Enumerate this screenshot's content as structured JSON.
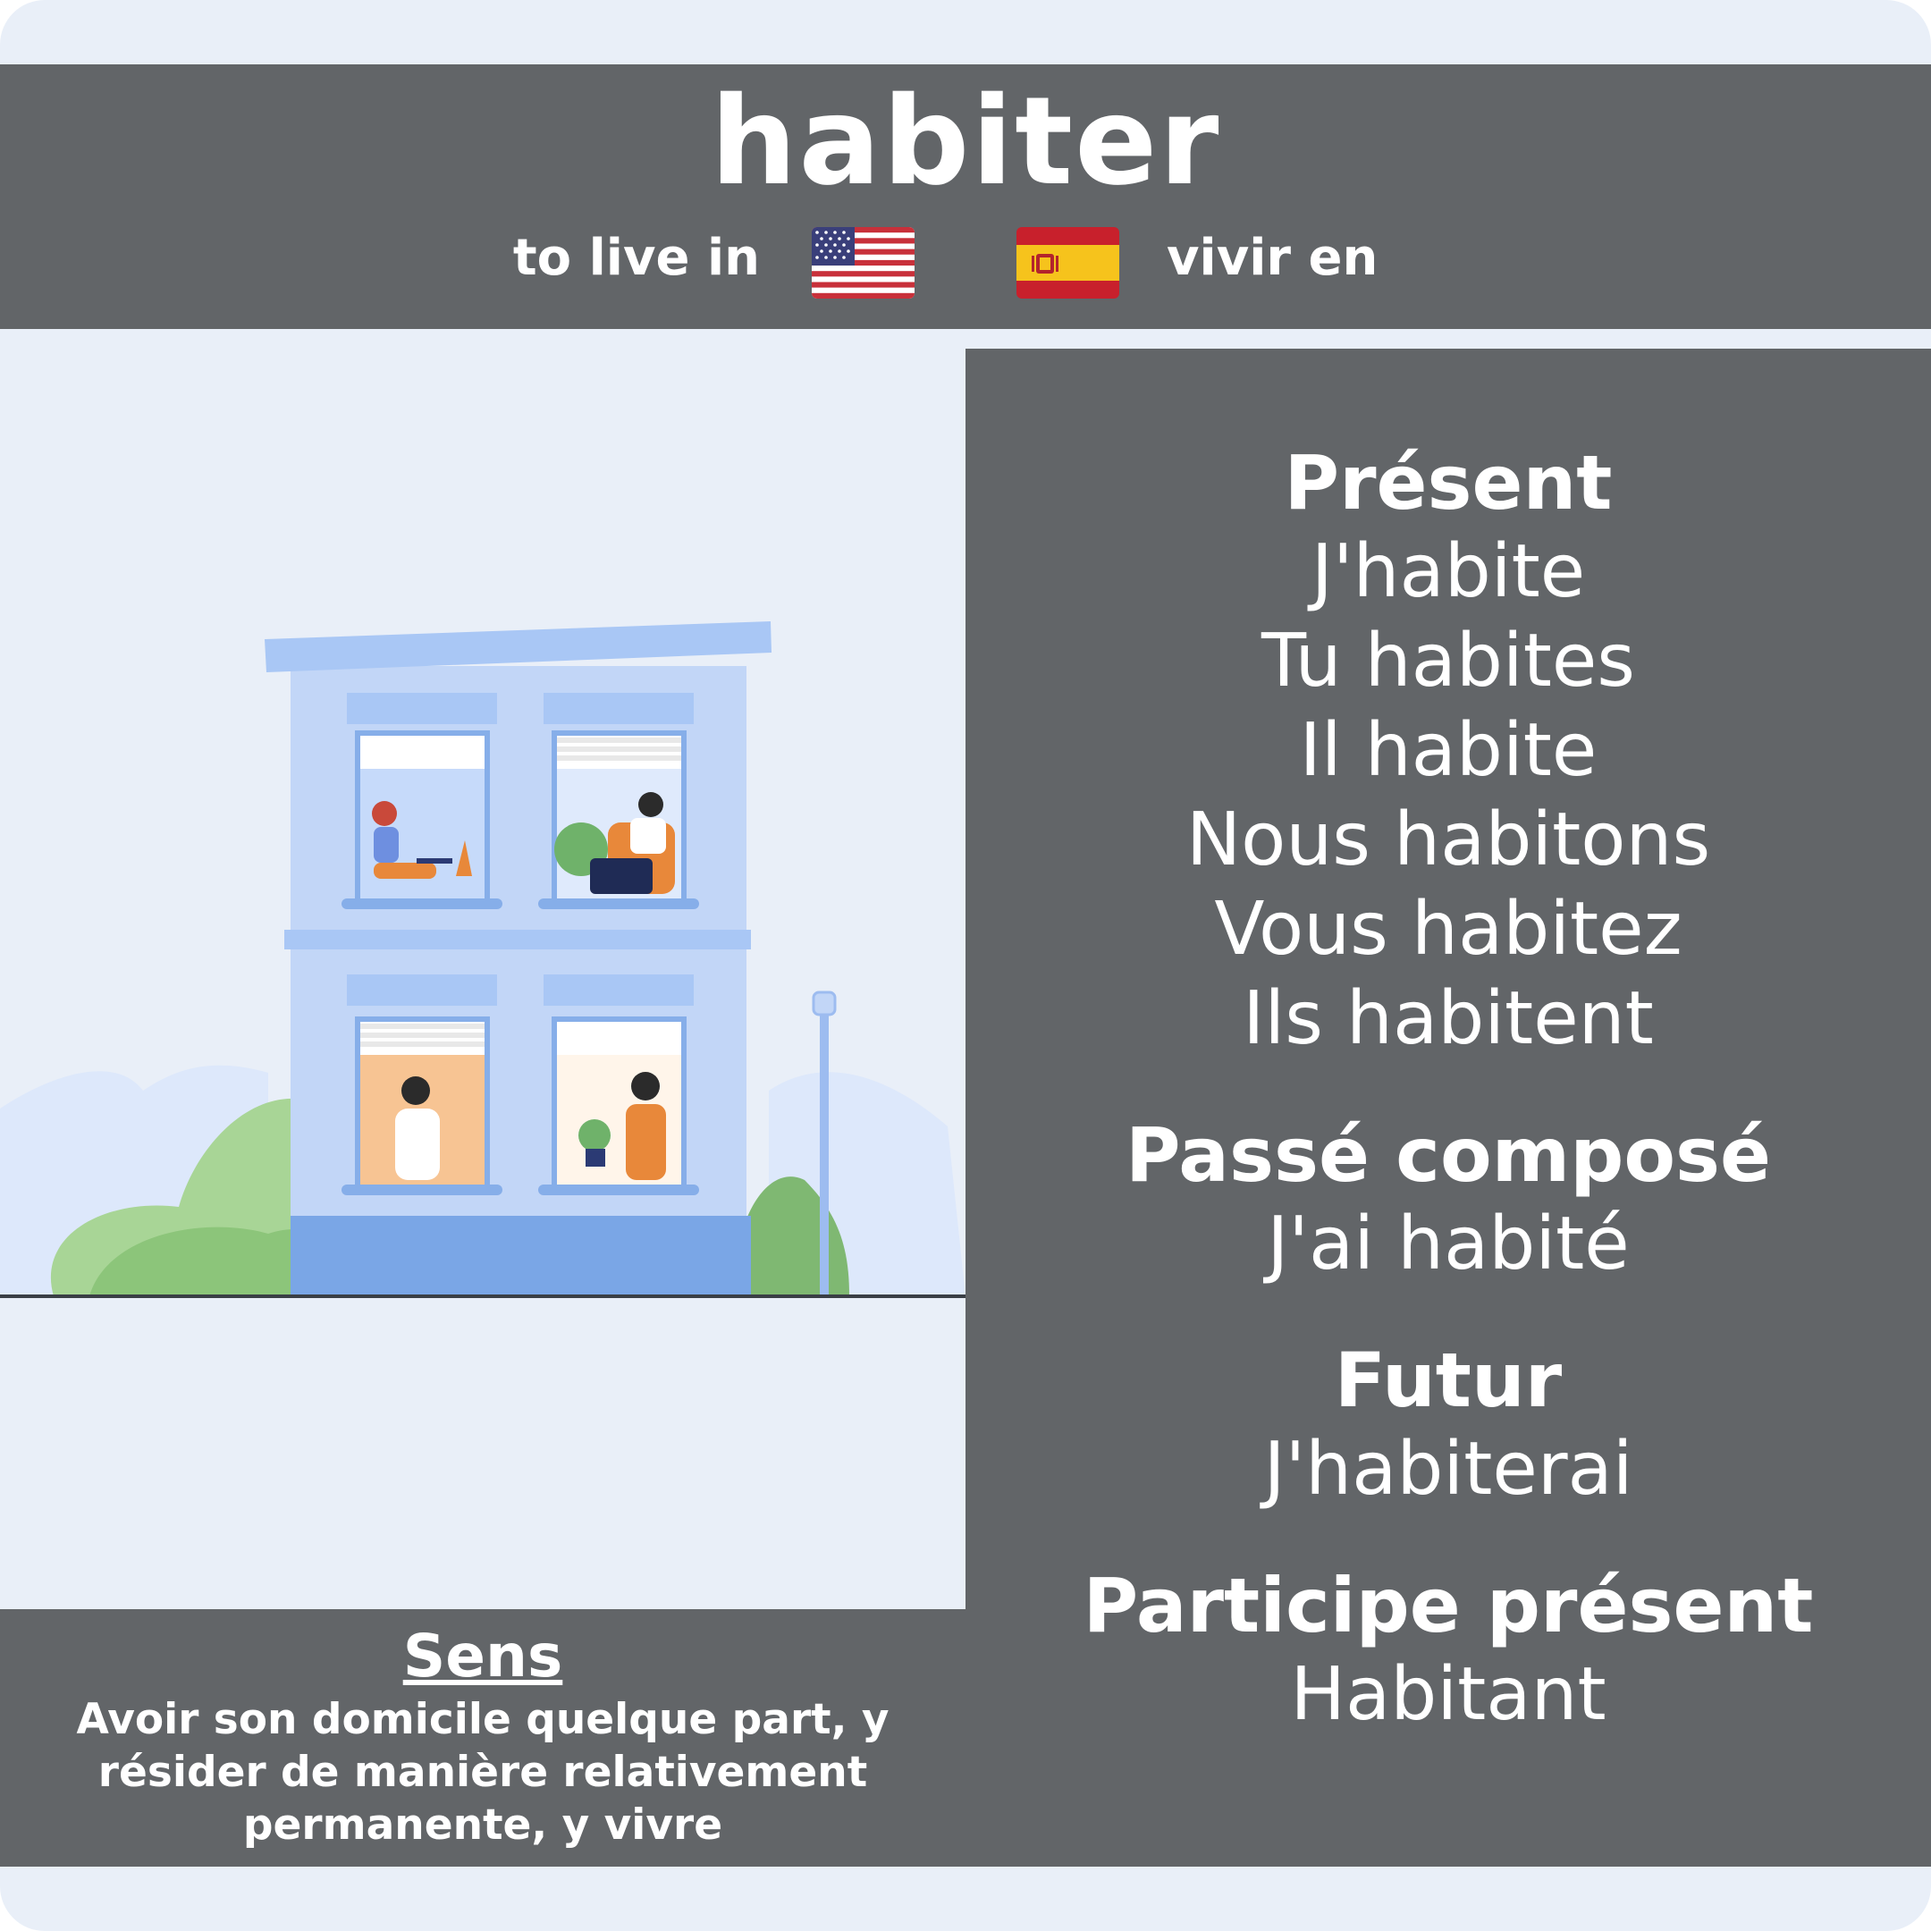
{
  "verb": "habiter",
  "translations": {
    "en": "to live in",
    "es": "vivir en"
  },
  "flags": {
    "en": "us-flag-icon",
    "es": "spain-flag-icon"
  },
  "illustration": "apartment-building-illustration",
  "conjugation": {
    "present": {
      "title": "Présent",
      "forms": [
        "J'habite",
        "Tu habites",
        "Il habite",
        "Nous habitons",
        "Vous habitez",
        "Ils habitent"
      ]
    },
    "passe_compose": {
      "title": "Passé composé",
      "form": "J'ai habité"
    },
    "futur": {
      "title": "Futur",
      "form": "J'habiterai"
    },
    "participe_present": {
      "title": "Participe présent",
      "form": "Habitant"
    }
  },
  "sens": {
    "title": "Sens",
    "text": "Avoir son domicile quelque part, y résider de manière relativement permanente, y vivre"
  },
  "colors": {
    "background": "#e9eff8",
    "panel": "#626568",
    "text": "#ffffff",
    "building": "#c2d6f7",
    "accent": "#7aa6e6"
  }
}
